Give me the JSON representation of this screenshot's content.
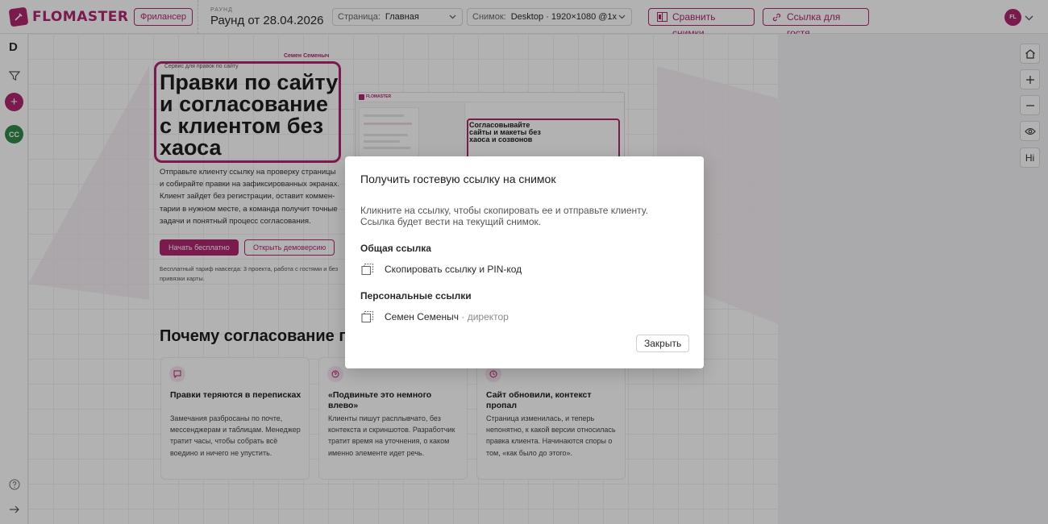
{
  "app": {
    "logo_text": "FLOMASTER",
    "brand_color": "#b0266f"
  },
  "topbar": {
    "freelancer_chip": "Фрилансер",
    "round_caption": "РАУНД",
    "round_title": "Раунд от 28.04.2026",
    "page_select": {
      "label": "Страница:",
      "value": "Главная"
    },
    "snapshot_select": {
      "label": "Снимок:",
      "value": "Desktop · 1920×1080 @1x"
    },
    "compare_button": "Сравнить снимки",
    "guest_link_button": "Ссылка для гостя",
    "user_initials": "FL"
  },
  "leftrail": {
    "letter": "D",
    "user_badge": "CC"
  },
  "rightrail": {
    "tool_hi": "Hi"
  },
  "preview": {
    "hero_small": "Сервис для правок по сайту",
    "hero_author": "Семен Семеныч",
    "hero_title": "Правки по сайту и согласование с клиентом без хаоса",
    "hero_desc": "Отправьте клиенту ссылку на проверку страницы и собирайте правки на зафиксированных экранах. Клиент зайдет без регистрации, оставит коммен-тарии в нужном месте, а команда получит точные задачи и понятный процесс согласования.",
    "hero_btn_primary": "Начать бесплатно",
    "hero_btn_secondary": "Открыть демоверсию",
    "hero_note": "Бесплатный тариф навсегда: 3 проекта, работа с гостями и без привязки карты.",
    "mock_logo": "FLOMASTER",
    "mock_title": "Согласовывайте сайты и макеты без хаоса и созвонов",
    "why_title": "Почему согласование пр",
    "cards": [
      {
        "title": "Правки теряются в переписках",
        "text": "Замечания разбросаны по почте, мессенджерам и таблицам. Менеджер тратит часы, чтобы собрать всё воедино и ничего не упустить."
      },
      {
        "title": "«Подвиньте это немного влево»",
        "text": "Клиенты пишут расплывчато, без контекста и скриншотов. Разработчик тратит время на уточнения, о каком именно элементе идет речь."
      },
      {
        "title": "Сайт обновили, контекст пропал",
        "text": "Страница изменилась, и теперь непонятно, к какой версии относилась правка клиента. Начинаются споры о том, «как было до этого»."
      }
    ]
  },
  "dialog": {
    "title": "Получить гостевую ссылку на снимок",
    "description": "Кликните на ссылку, чтобы скопировать ее и отправьте клиенту. Ссылка будет вести на текущий снимок.",
    "shared_section": "Общая ссылка",
    "shared_link": "Скопировать ссылку и PIN-код",
    "personal_section": "Персональные ссылки",
    "personal_links": [
      {
        "name": "Семен Семеныч",
        "separator": "·",
        "role": "директор"
      }
    ],
    "close_button": "Закрыть"
  }
}
